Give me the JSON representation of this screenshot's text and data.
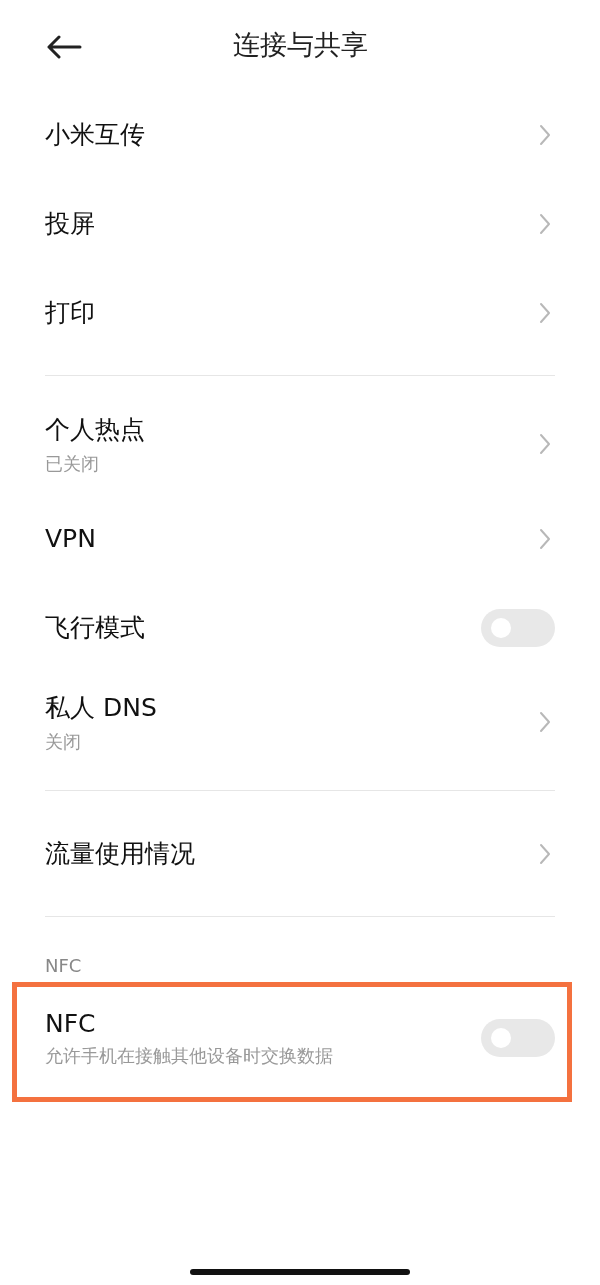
{
  "header": {
    "title": "连接与共享"
  },
  "groups": [
    {
      "items": [
        {
          "kind": "link",
          "title": "小米互传"
        },
        {
          "kind": "link",
          "title": "投屏"
        },
        {
          "kind": "link",
          "title": "打印"
        }
      ]
    },
    {
      "items": [
        {
          "kind": "link",
          "title": "个人热点",
          "subtitle": "已关闭"
        },
        {
          "kind": "link",
          "title": "VPN"
        },
        {
          "kind": "toggle",
          "title": "飞行模式",
          "on": false
        },
        {
          "kind": "link",
          "title": "私人 DNS",
          "subtitle": "关闭"
        }
      ]
    },
    {
      "items": [
        {
          "kind": "link",
          "title": "流量使用情况"
        }
      ]
    },
    {
      "label": "NFC",
      "items": [
        {
          "kind": "toggle",
          "title": "NFC",
          "subtitle": "允许手机在接触其他设备时交换数据",
          "on": false,
          "highlighted": true
        }
      ]
    }
  ]
}
